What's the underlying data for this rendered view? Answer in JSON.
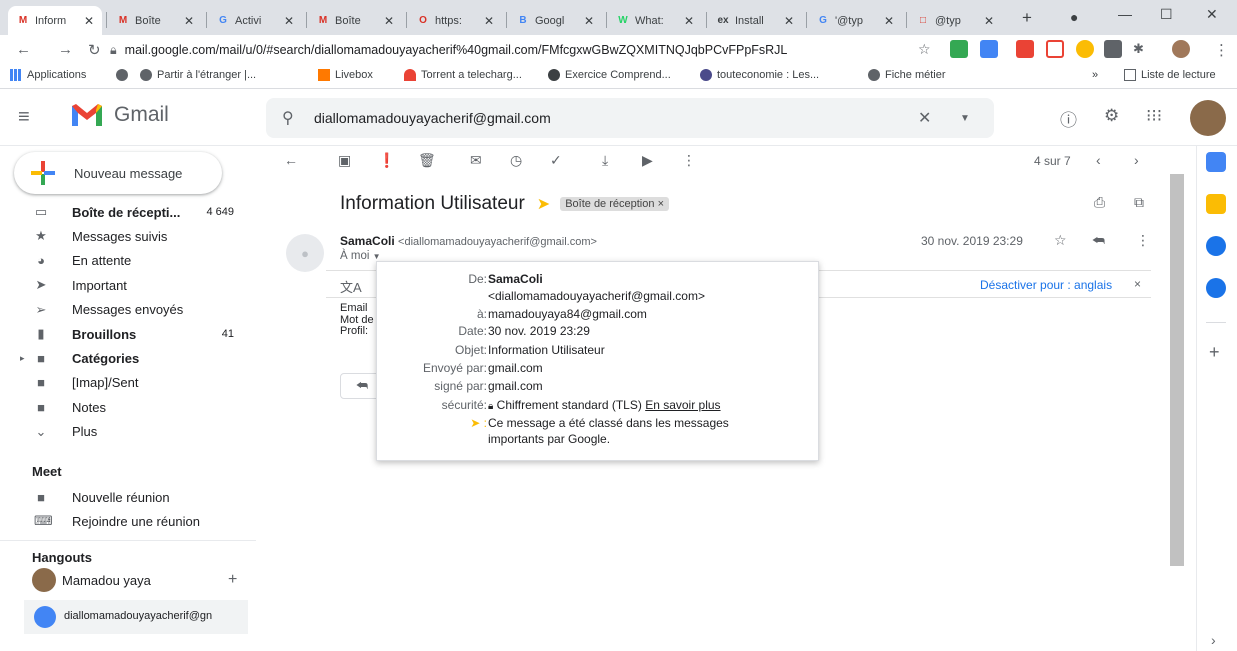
{
  "browser": {
    "tabs": [
      {
        "label": "Inform",
        "fav": "M",
        "color": "#d93025"
      },
      {
        "label": "Boîte",
        "fav": "M",
        "color": "#d93025"
      },
      {
        "label": "Activi",
        "fav": "G",
        "color": "#4285f4"
      },
      {
        "label": "Boîte",
        "fav": "M",
        "color": "#d93025"
      },
      {
        "label": "https:",
        "fav": "O",
        "color": "#d93025"
      },
      {
        "label": "Googl",
        "fav": "B",
        "color": "#4285f4"
      },
      {
        "label": "What:",
        "fav": "W",
        "color": "#25d366"
      },
      {
        "label": "Install",
        "fav": "ex",
        "color": "#3c4043"
      },
      {
        "label": "'@typ",
        "fav": "G",
        "color": "#4285f4"
      },
      {
        "label": "@typ",
        "fav": "□",
        "color": "#d93025"
      }
    ],
    "new_tab": "+",
    "url": "mail.google.com/mail/u/0/#search/diallomamadouyayacherif%40gmail.com/FMfcgxwGBwZQXMITNQJqbPCvFPpFsRJL",
    "bookmarks": [
      {
        "label": "Applications"
      },
      {
        "label": ""
      },
      {
        "label": "Partir à l'étranger |..."
      },
      {
        "label": "Livebox"
      },
      {
        "label": "Torrent a telecharg..."
      },
      {
        "label": "Exercice Comprend..."
      },
      {
        "label": "touteconomie : Les..."
      },
      {
        "label": "Fiche métier"
      }
    ],
    "reading_list": "Liste de lecture",
    "more": "»"
  },
  "gmail": {
    "logo_text": "Gmail",
    "search_query": "diallomamadouyayacherif@gmail.com",
    "compose": "Nouveau message",
    "nav": [
      {
        "label": "Boîte de récepti...",
        "count": "4 649",
        "bold": true,
        "icon": "inbox-icon"
      },
      {
        "label": "Messages suivis",
        "count": "",
        "bold": false,
        "icon": "star-icon"
      },
      {
        "label": "En attente",
        "count": "",
        "bold": false,
        "icon": "clock-icon"
      },
      {
        "label": "Important",
        "count": "",
        "bold": false,
        "icon": "important-icon"
      },
      {
        "label": "Messages envoyés",
        "count": "",
        "bold": false,
        "icon": "send-icon"
      },
      {
        "label": "Brouillons",
        "count": "41",
        "bold": true,
        "icon": "draft-icon"
      },
      {
        "label": "Catégories",
        "count": "",
        "bold": true,
        "icon": "label-icon"
      },
      {
        "label": "[Imap]/Sent",
        "count": "",
        "bold": false,
        "icon": "label-icon"
      },
      {
        "label": "Notes",
        "count": "",
        "bold": false,
        "icon": "label-icon"
      },
      {
        "label": "Plus",
        "count": "",
        "bold": false,
        "icon": "chevron-down-icon"
      }
    ],
    "meet": {
      "title": "Meet",
      "items": [
        "Nouvelle réunion",
        "Rejoindre une réunion"
      ]
    },
    "hangouts": {
      "title": "Hangouts",
      "user": "Mamadou yaya",
      "contact": "diallomamadouyayacherif@gn"
    },
    "pager": "4 sur 7",
    "subject": "Information Utilisateur",
    "label": "Boîte de réception",
    "sender_name": "SamaColi",
    "sender_email": "<diallomamadouyayacherif@gmail.com>",
    "to_me": "À moi",
    "date": "30 nov. 2019 23:29",
    "translate_off": "Désactiver pour : anglais",
    "body": [
      "Email",
      "Mot de",
      "Profil:"
    ],
    "details": [
      {
        "k": "De:",
        "v": "SamaColi",
        "bold": true
      },
      {
        "k": "",
        "v": "<diallomamadouyayacherif@gmail.com>",
        "bold": false
      },
      {
        "k": "à:",
        "v": "mamadouyaya84@gmail.com",
        "bold": false
      },
      {
        "k": "Date:",
        "v": "30 nov. 2019 23:29",
        "bold": false
      },
      {
        "k": "Objet:",
        "v": "Information Utilisateur",
        "bold": false
      },
      {
        "k": "Envoyé par:",
        "v": "gmail.com",
        "bold": false
      },
      {
        "k": "signé par:",
        "v": "gmail.com",
        "bold": false
      }
    ],
    "security_key": "sécurité:",
    "security_value": "Chiffrement standard (TLS)",
    "security_link": "En savoir plus",
    "important_note_1": "Ce message a été classé dans les messages",
    "important_note_2": "importants par Google.",
    "colors": {
      "red": "#ea4335",
      "yellow": "#fbbc04",
      "blue": "#4285f4",
      "green": "#34a853"
    }
  }
}
